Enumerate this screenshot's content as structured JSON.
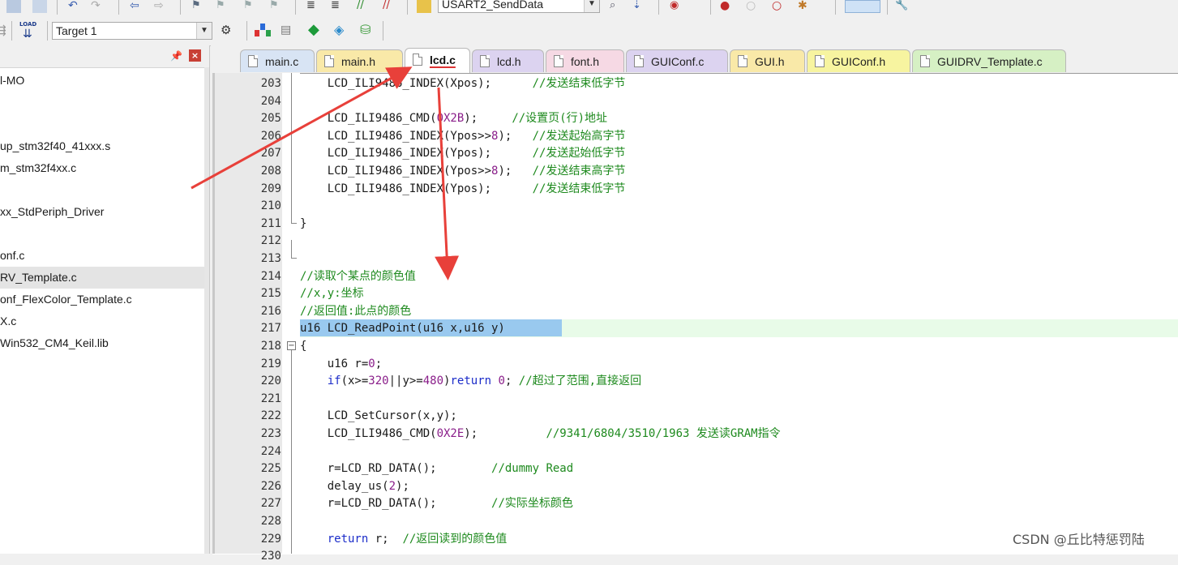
{
  "toolbar": {
    "function_combo_value": "USART2_SendData",
    "target_combo_value": "Target 1",
    "load_label": "LOAD"
  },
  "project_panel": {
    "items": [
      {
        "label": "l-MO"
      },
      {
        "label": ""
      },
      {
        "label": ""
      },
      {
        "label": "up_stm32f40_41xxx.s"
      },
      {
        "label": "m_stm32f4xx.c"
      },
      {
        "label": ""
      },
      {
        "label": "xx_StdPeriph_Driver"
      },
      {
        "label": ""
      },
      {
        "label": "onf.c"
      },
      {
        "label": "RV_Template.c",
        "selected": true
      },
      {
        "label": "onf_FlexColor_Template.c"
      },
      {
        "label": "X.c"
      },
      {
        "label": "Win532_CM4_Keil.lib"
      }
    ]
  },
  "tabs": [
    {
      "label": "main.c",
      "color": "#d8e4f4"
    },
    {
      "label": "main.h",
      "color": "#f9e9a8"
    },
    {
      "label": "lcd.c",
      "color": "#ffffff",
      "active": true
    },
    {
      "label": "lcd.h",
      "color": "#dcd3f0"
    },
    {
      "label": "font.h",
      "color": "#f6d9e4"
    },
    {
      "label": "GUIConf.c",
      "color": "#dcd3f0"
    },
    {
      "label": "GUI.h",
      "color": "#f9e9a8"
    },
    {
      "label": "GUIConf.h",
      "color": "#f7f4a0"
    },
    {
      "label": "GUIDRV_Template.c",
      "color": "#d6f0c4"
    }
  ],
  "code_lines": [
    {
      "n": "203",
      "text": "    LCD_ILI9486_INDEX(Xpos);      //发送结束低字节"
    },
    {
      "n": "204",
      "text": ""
    },
    {
      "n": "205",
      "text": "    LCD_ILI9486_CMD(0X2B);     //设置页(行)地址"
    },
    {
      "n": "206",
      "text": "    LCD_ILI9486_INDEX(Ypos>>8);   //发送起始高字节"
    },
    {
      "n": "207",
      "text": "    LCD_ILI9486_INDEX(Ypos);      //发送起始低字节"
    },
    {
      "n": "208",
      "text": "    LCD_ILI9486_INDEX(Ypos>>8);   //发送结束高字节"
    },
    {
      "n": "209",
      "text": "    LCD_ILI9486_INDEX(Ypos);      //发送结束低字节"
    },
    {
      "n": "210",
      "text": ""
    },
    {
      "n": "211",
      "text": "}"
    },
    {
      "n": "212",
      "text": ""
    },
    {
      "n": "213",
      "text": ""
    },
    {
      "n": "214",
      "text": "//读取个某点的颜色值"
    },
    {
      "n": "215",
      "text": "//x,y:坐标"
    },
    {
      "n": "216",
      "text": "//返回值:此点的颜色"
    },
    {
      "n": "217",
      "text": "u16 LCD_ReadPoint(u16 x,u16 y)"
    },
    {
      "n": "218",
      "text": "{"
    },
    {
      "n": "219",
      "text": "    u16 r=0;"
    },
    {
      "n": "220",
      "text": "    if(x>=320||y>=480)return 0; //超过了范围,直接返回"
    },
    {
      "n": "221",
      "text": ""
    },
    {
      "n": "222",
      "text": "    LCD_SetCursor(x,y);"
    },
    {
      "n": "223",
      "text": "    LCD_ILI9486_CMD(0X2E);          //9341/6804/3510/1963 发送读GRAM指令"
    },
    {
      "n": "224",
      "text": ""
    },
    {
      "n": "225",
      "text": "    r=LCD_RD_DATA();        //dummy Read"
    },
    {
      "n": "226",
      "text": "    delay_us(2);"
    },
    {
      "n": "227",
      "text": "    r=LCD_RD_DATA();        //实际坐标颜色"
    },
    {
      "n": "228",
      "text": ""
    },
    {
      "n": "229",
      "text": "    return r;  //返回读到的颜色值"
    },
    {
      "n": "230",
      "text": ""
    }
  ],
  "watermark": "CSDN @丘比特惩罚陆",
  "colors": {
    "keyword": "#1b2cc9",
    "comment": "#1e8a1e",
    "number": "#8a1e8a",
    "arrow": "#e8403a",
    "selection": "#99c9ef",
    "current_line": "#e8fbe8"
  }
}
